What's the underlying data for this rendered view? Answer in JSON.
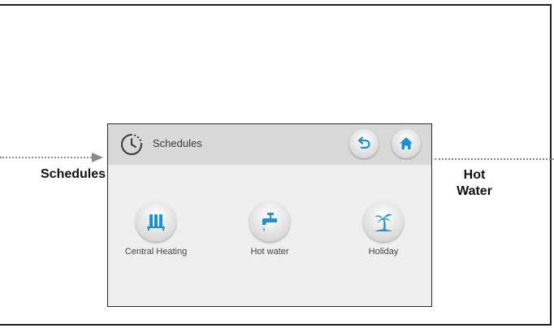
{
  "annotations": {
    "left_label": "Schedules",
    "right_label_line1": "Hot",
    "right_label_line2": "Water"
  },
  "screen": {
    "title": "Schedules",
    "title_icon": "clock-schedule-icon",
    "buttons": [
      {
        "icon": "back-arrow-icon"
      },
      {
        "icon": "home-icon"
      }
    ],
    "tiles": [
      {
        "label": "Central Heating",
        "icon": "radiator-icon"
      },
      {
        "label": "Hot water",
        "icon": "tap-icon"
      },
      {
        "label": "Holiday",
        "icon": "palm-tree-icon"
      }
    ]
  },
  "colors": {
    "accent": "#1e90d6",
    "header_bg": "#d9d9d9",
    "screen_bg": "#efefef"
  }
}
